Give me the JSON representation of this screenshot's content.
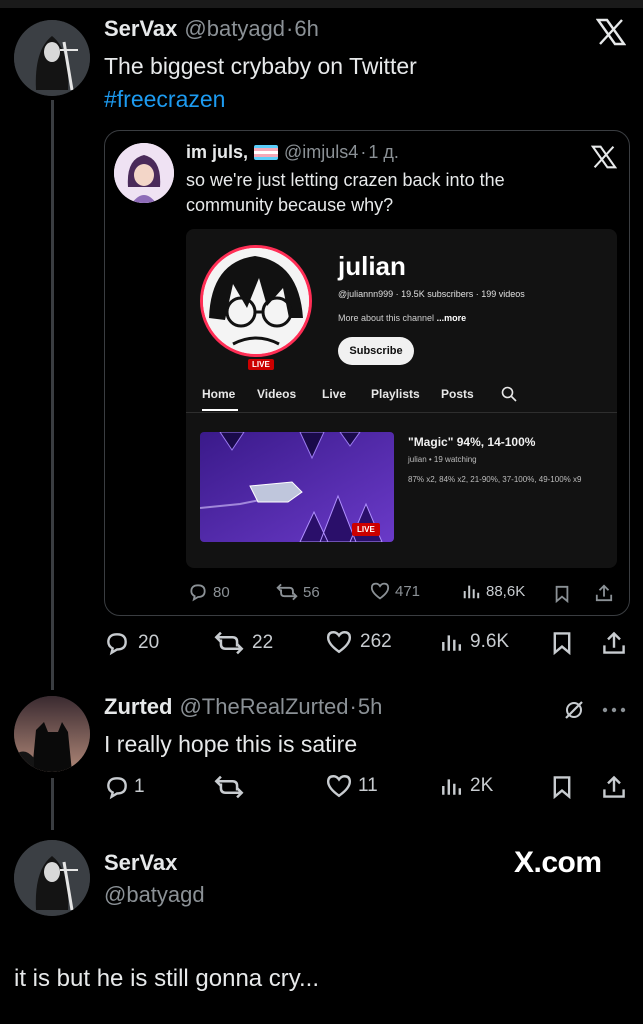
{
  "tweet1": {
    "name": "SerVax",
    "handle": "@batyagd",
    "sep": "·",
    "time": "6h",
    "text": "The biggest crybaby on Twitter",
    "hashtag": "#freecrazen",
    "stats": {
      "replies": "20",
      "retweets": "22",
      "likes": "262",
      "views": "9.6K"
    }
  },
  "quote": {
    "name": "im juls,",
    "handle": "@imjuls4",
    "sep": "·",
    "time": "1 д.",
    "text": "so we're just letting crazen back into the community because why?",
    "stats": {
      "replies": "80",
      "retweets": "56",
      "likes": "471",
      "views": "88,6K"
    }
  },
  "youtube": {
    "channel_name": "julian",
    "channel_meta": "@juliannn999 · 19.5K subscribers · 199 videos",
    "about": "More about this channel",
    "about_more": "...more",
    "subscribe": "Subscribe",
    "live_badge": "LIVE",
    "tabs": [
      "Home",
      "Videos",
      "Live",
      "Playlists",
      "Posts"
    ],
    "video_title": "\"Magic\" 94%, 14-100%",
    "video_meta": "julian • 19 watching",
    "video_desc": "87% x2, 84% x2, 21-90%, 37-100%, 49-100% x9",
    "thumb_live": "LIVE"
  },
  "tweet2": {
    "name": "Zurted",
    "handle": "@TheRealZurted",
    "sep": "·",
    "time": "5h",
    "text": "I really hope this is satire",
    "stats": {
      "replies": "1",
      "retweets": "",
      "likes": "11",
      "views": "2K"
    }
  },
  "tweet3": {
    "name": "SerVax",
    "handle": "@batyagd",
    "brand": "X.com",
    "text": "it is but he is still gonna cry..."
  },
  "colors": {
    "accent": "#1d9bf0",
    "bg": "#000000",
    "muted": "#8b9196",
    "live": "#cc0000"
  }
}
